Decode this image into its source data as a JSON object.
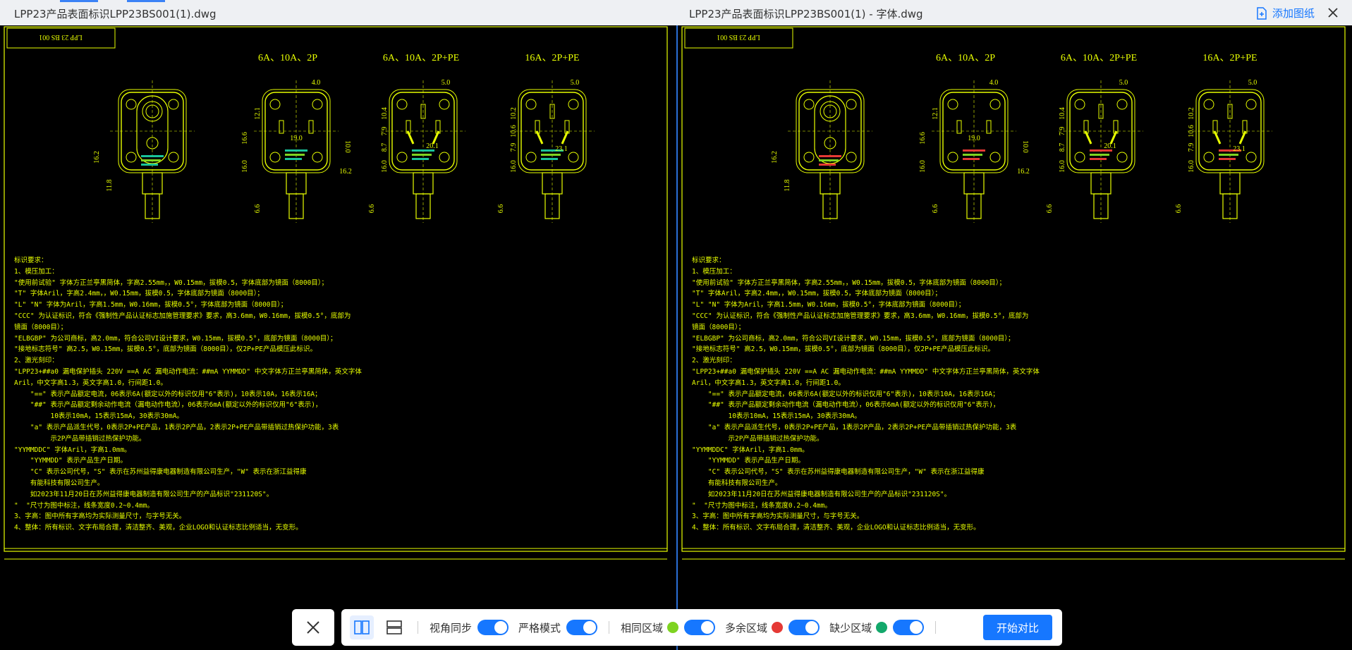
{
  "header": {
    "left_title": "LPP23产品表面标识LPP23BS001(1).dwg",
    "right_title": "LPP23产品表面标识LPP23BS001(1) - 字体.dwg",
    "add_label": "添加图纸"
  },
  "drawing": {
    "box_label": "LPP 23 BS 001",
    "headers": [
      "6A、10A、2P",
      "6A、10A、2P+PE",
      "16A、2P+PE"
    ],
    "dims": {
      "d40": "4.0",
      "d50": "5.0",
      "d190": "19.0",
      "d201": "20.1",
      "d231": "23.1",
      "d100": "10.0",
      "d162": "16.2",
      "d118": "11.8",
      "d166": "16.6",
      "d160": "16.0",
      "d121": "12.1",
      "d66": "6.6",
      "d87": "8.7",
      "d79": "7.9",
      "d104": "10.4",
      "d102": "10.2",
      "d106": "10.6"
    },
    "notes": [
      "标识要求：",
      "1、模压加工：",
      "\"使用前试验\" 字体方正兰亭黑简体，字高2.55mm，，W0.15mm，拔模0.5，字体底部为镜面（8000目）；",
      "\"T\" 字体Aril，字高2.4mm，，W0.15mm，拔模0.5，字体底部为镜面（8000目）；",
      "\"L\" \"N\" 字体为Aril，字高1.5mm，W0.16mm，拔模0.5°，字体底部为镜面（8000目）；",
      "\"CCC\" 为认证标识，符合《强制性产品认证标志加施管理要求》要求，高3.6mm，W0.16mm，拔模0.5°，底部为",
      "镜面（8000目）；",
      "\"ELBGBP\" 为公司商标，高2.0mm，符合公司VI设计要求，W0.15mm，拔模0.5°，底部为镜面（8000目）；",
      "\"接地标志符号\" 高2.5，W0.15mm，拔模0.5°，底部为镜面（8000目），仅2P+PE产品模压此标识。",
      "2、激光刻印：",
      "\"LPP23+##a0 漏电保护插头 220V ==A AC 漏电动作电流：##mA YYMMDD\" 中文字体方正兰亭黑简体，英文字体",
      "Aril，中文字高1.3，英文字高1.0，行间距1.0。",
      "    \"==\" 表示产品额定电流，06表示6A(额定以外的标识仅用\"6\"表示)，10表示10A，16表示16A；",
      "    \"##\" 表示产品额定剩余动作电流（漏电动作电流），06表示6mA(额定以外的标识仅用\"6\"表示)，",
      "         10表示10mA，15表示15mA，30表示30mA。",
      "    \"a\" 表示产品派生代号，0表示2P+PE产品，1表示2P产品，2表示2P+PE产品带插销过热保护功能，3表",
      "         示2P产品带插销过热保护功能。",
      "\"YYMMDDC\" 字体Aril，字高1.0mm。",
      "    \"YYMMDD\" 表示产品生产日期。",
      "    \"C\" 表示公司代号，\"S\" 表示在苏州益得康电器制造有限公司生产，\"W\" 表示在浙江益得康",
      "    有能科技有限公司生产。",
      "    如2023年11月20日在苏州益得康电器制造有限公司生产的产品标识\"231120S\"。",
      "\"  \"尺寸为图中标注，线条宽度0.2~0.4mm。",
      "3、字高：图中所有字高均为实际测量尺寸，与字号无关。",
      "4、整体：所有标识、文字布局合理，清洁整齐、美观，企业LOGO和认证标志比例适当，无变形。"
    ]
  },
  "toolbar": {
    "view_sync": "视角同步",
    "strict_mode": "严格模式",
    "same_area": "相同区域",
    "extra_area": "多余区域",
    "missing_area": "缺少区域",
    "start": "开始对比"
  },
  "colors": {
    "cad_line": "#e8ff00",
    "accent": "#1677ff",
    "same": "#7ed321",
    "extra": "#e53935",
    "missing": "#13a86b"
  }
}
